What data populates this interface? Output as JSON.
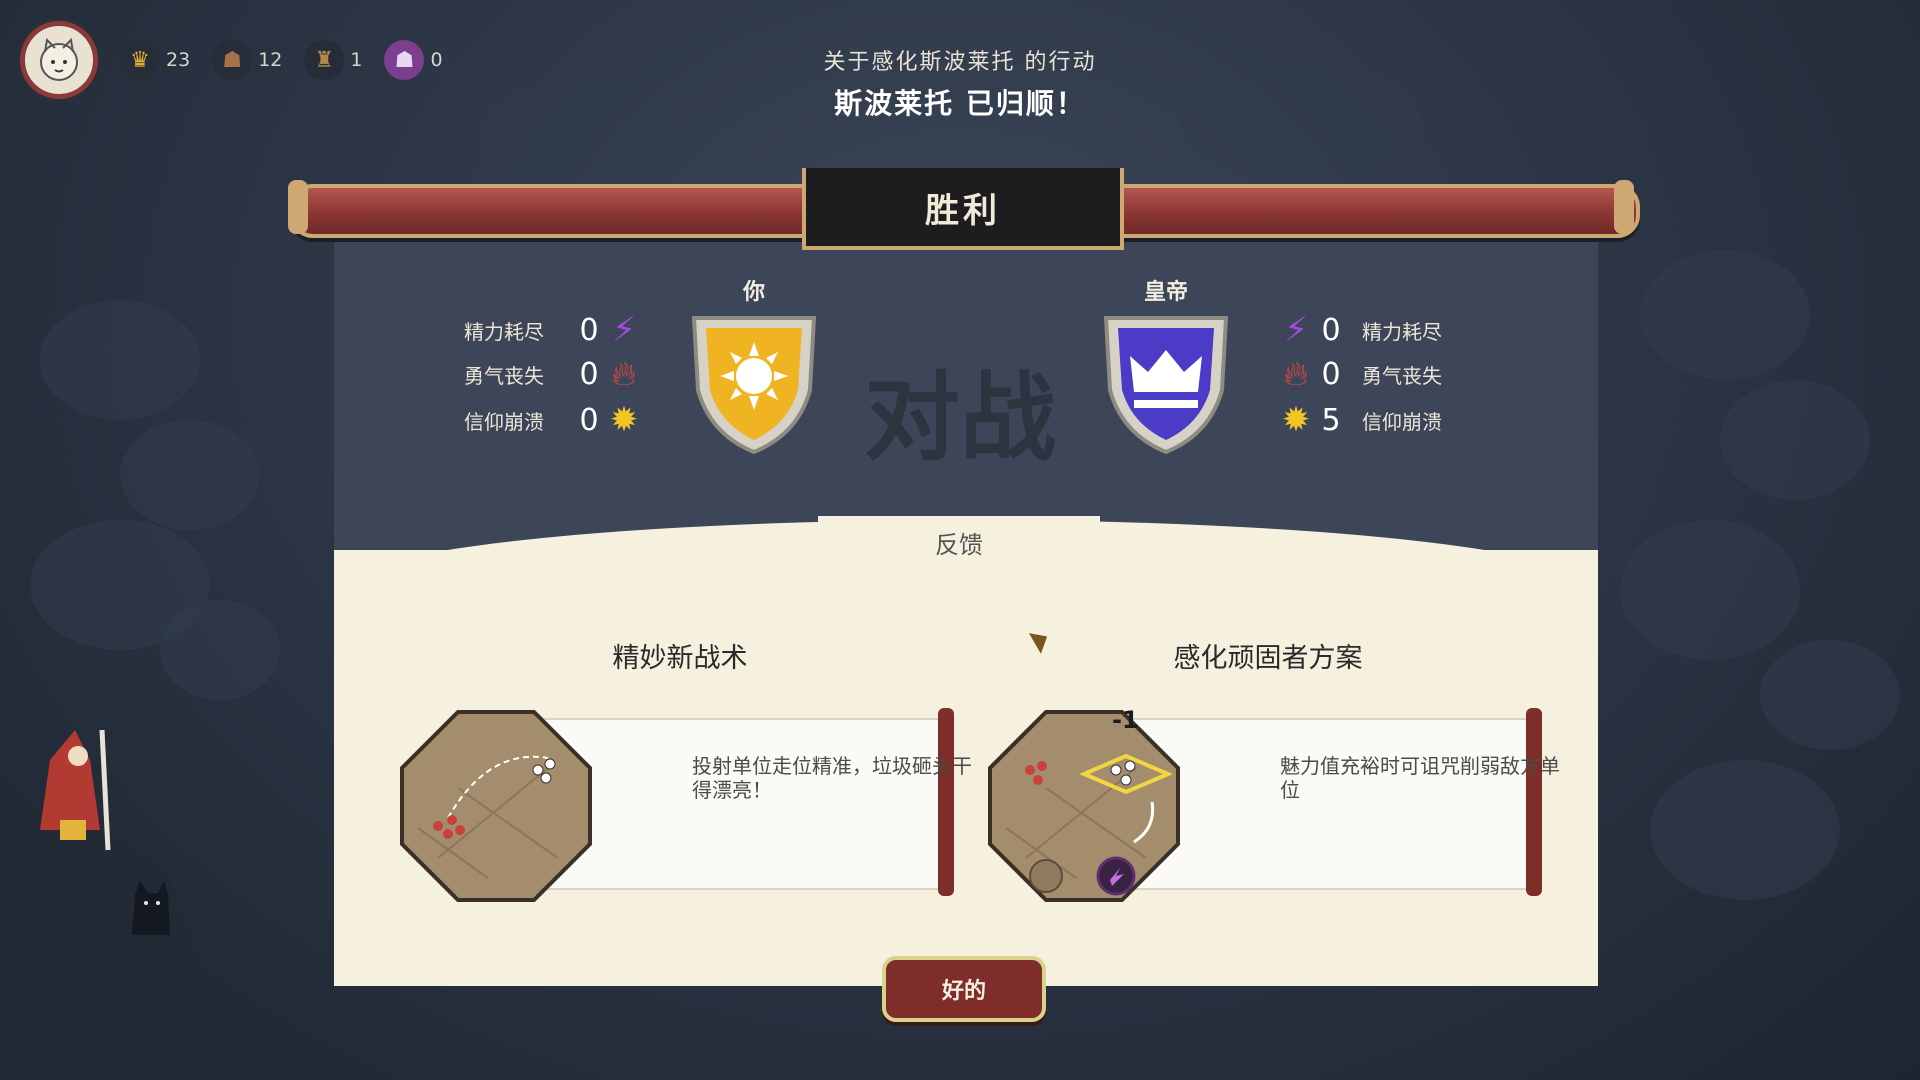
{
  "hud": {
    "crowns": "23",
    "followers": "12",
    "buildings": "1",
    "special": "0"
  },
  "header": {
    "subtitle": "关于感化斯波莱托 的行动",
    "title": "斯波莱托 已归顺！"
  },
  "result_banner": "胜利",
  "versus_label": "对战",
  "player": {
    "name": "你",
    "stats": [
      {
        "label": "精力耗尽",
        "value": "0",
        "icon": "lightning-icon"
      },
      {
        "label": "勇气丧失",
        "value": "0",
        "icon": "flame-icon"
      },
      {
        "label": "信仰崩溃",
        "value": "0",
        "icon": "burst-icon"
      }
    ]
  },
  "enemy": {
    "name": "皇帝",
    "stats": [
      {
        "label": "精力耗尽",
        "value": "0",
        "icon": "lightning-icon"
      },
      {
        "label": "勇气丧失",
        "value": "0",
        "icon": "flame-icon"
      },
      {
        "label": "信仰崩溃",
        "value": "5",
        "icon": "burst-icon"
      }
    ]
  },
  "feedback_tab": "反馈",
  "cards": [
    {
      "title": "精妙新战术",
      "description": "投射单位走位精准，垃圾砸头干得漂亮！"
    },
    {
      "title": "感化顽固者方案",
      "description": "魅力值充裕时可诅咒削弱敌方单位",
      "badge": "-1"
    }
  ],
  "ok_button": "好的",
  "colors": {
    "background": "#2a3342",
    "panel": "#3d4558",
    "paper": "#f6f0de",
    "banner_red": "#8b3733",
    "gold": "#cda873",
    "player_shield": "#f0b422",
    "enemy_shield": "#4b3bc6"
  }
}
